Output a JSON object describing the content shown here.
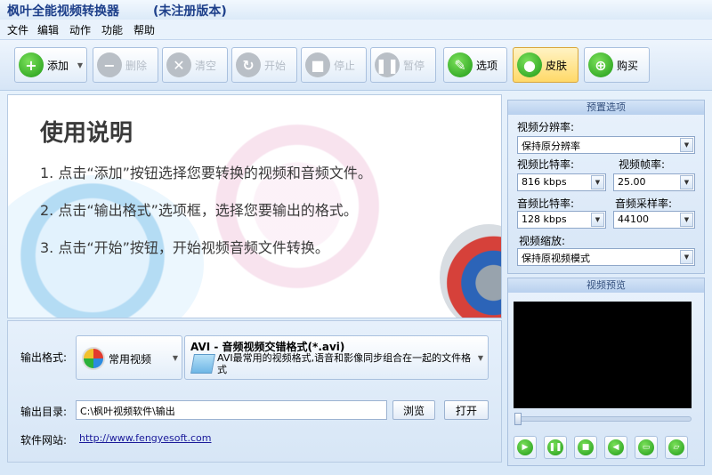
{
  "app": {
    "title": "枫叶全能视频转换器",
    "subtitle": "(未注册版本)"
  },
  "menu": [
    "文件",
    "编辑",
    "动作",
    "功能",
    "帮助"
  ],
  "toolbar": {
    "add": "添加",
    "delete": "删除",
    "clear": "清空",
    "start": "开始",
    "stop": "停止",
    "pause": "暂停",
    "options": "选项",
    "skin": "皮肤",
    "buy": "购买"
  },
  "guide": {
    "title": "使用说明",
    "steps": [
      "1. 点击“添加”按钮选择您要转换的视频和音频文件。",
      "2. 点击“输出格式”选项框，选择您要输出的格式。",
      "3. 点击“开始”按钮，开始视频音频文件转换。"
    ]
  },
  "output": {
    "format_label": "输出格式:",
    "format_category": "常用视频",
    "format_name": "AVI - 音频视频交错格式(*.avi)",
    "format_desc": "AVI最常用的视频格式,语音和影像同步组合在一起的文件格式",
    "dir_label": "输出目录:",
    "dir_value": "C:\\枫叶视频软件\\输出",
    "browse": "浏览",
    "open": "打开",
    "site_label": "软件网站:",
    "site_url": "http://www.fengyesoft.com"
  },
  "preset": {
    "header": "预置选项",
    "resolution_label": "视频分辨率:",
    "resolution_value": "保持原分辨率",
    "vbitrate_label": "视频比特率:",
    "vbitrate_value": "816 kbps",
    "fps_label": "视频帧率:",
    "fps_value": "25.00",
    "abitrate_label": "音频比特率:",
    "abitrate_value": "128 kbps",
    "samplerate_label": "音频采样率:",
    "samplerate_value": "44100",
    "scale_label": "视频缩放:",
    "scale_value": "保持原视频模式"
  },
  "preview": {
    "header": "视频预览",
    "seek_position": 0
  },
  "colors": {
    "title_text": "#1d3f8a",
    "accent_green": "#1f9a17",
    "skin_active": "#ffd968",
    "preview_bg": "#000000"
  },
  "icons": {
    "add": "plus-circle-icon",
    "delete": "minus-circle-icon",
    "clear": "x-circle-icon",
    "start": "refresh-icon",
    "stop": "stop-icon",
    "pause": "pause-icon",
    "options": "tools-icon",
    "skin": "apple-icon",
    "buy": "cart-icon"
  }
}
